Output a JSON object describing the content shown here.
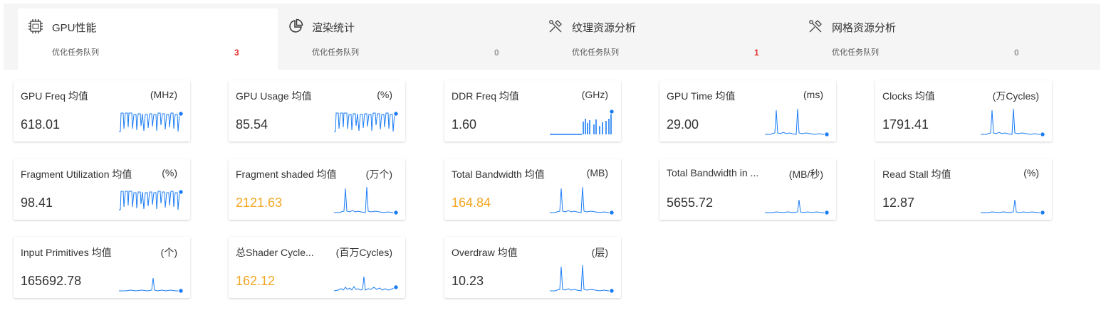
{
  "tabs": [
    {
      "id": "gpu",
      "title": "GPU性能",
      "sub": "优化任务队列",
      "count": "3",
      "count_color": "#e5322d",
      "icon": "gpu-chip-icon",
      "active": true
    },
    {
      "id": "render",
      "title": "渲染统计",
      "sub": "优化任务队列",
      "count": "0",
      "count_color": "#999999",
      "icon": "pie-chart-icon",
      "active": false
    },
    {
      "id": "texture",
      "title": "纹理资源分析",
      "sub": "优化任务队列",
      "count": "1",
      "count_color": "#e5322d",
      "icon": "tools-icon",
      "active": false
    },
    {
      "id": "mesh",
      "title": "网格资源分析",
      "sub": "优化任务队列",
      "count": "0",
      "count_color": "#999999",
      "icon": "tools-icon",
      "active": false
    }
  ],
  "metrics": [
    {
      "label": "GPU Freq 均值",
      "unit": "(MHz)",
      "value": "618.01",
      "warn": false,
      "spark": "dense-high"
    },
    {
      "label": "GPU Usage 均值",
      "unit": "(%)",
      "value": "85.54",
      "warn": false,
      "spark": "dense-high"
    },
    {
      "label": "DDR Freq 均值",
      "unit": "(GHz)",
      "value": "1.60",
      "warn": false,
      "spark": "bars"
    },
    {
      "label": "GPU Time 均值",
      "unit": "(ms)",
      "value": "29.00",
      "warn": false,
      "spark": "spikes"
    },
    {
      "label": "Clocks 均值",
      "unit": "(万Cycles)",
      "value": "1791.41",
      "warn": false,
      "spark": "spikes"
    },
    {
      "label": "Fragment Utilization 均值",
      "unit": "(%)",
      "value": "98.41",
      "warn": false,
      "spark": "dense-high"
    },
    {
      "label": "Fragment shaded 均值",
      "unit": "(万个)",
      "value": "2121.63",
      "warn": true,
      "spark": "spikes"
    },
    {
      "label": "Total Bandwidth 均值",
      "unit": "(MB)",
      "value": "164.84",
      "warn": true,
      "spark": "spikes"
    },
    {
      "label": "Total Bandwidth in ...",
      "unit": "(MB/秒)",
      "value": "5655.72",
      "warn": false,
      "spark": "single"
    },
    {
      "label": "Read Stall 均值",
      "unit": "(%)",
      "value": "12.87",
      "warn": false,
      "spark": "single"
    },
    {
      "label": "Input Primitives 均值",
      "unit": "(个)",
      "value": "165692.78",
      "warn": false,
      "spark": "single"
    },
    {
      "label": "总Shader Cycle...",
      "unit": "(百万Cycles)",
      "value": "162.12",
      "warn": true,
      "spark": "noisy"
    },
    {
      "label": "Overdraw 均值",
      "unit": "(层)",
      "value": "10.23",
      "warn": false,
      "spark": "spikes"
    }
  ],
  "colors": {
    "accent": "#1a7cf5",
    "warn": "#f5a623",
    "danger": "#e5322d"
  }
}
